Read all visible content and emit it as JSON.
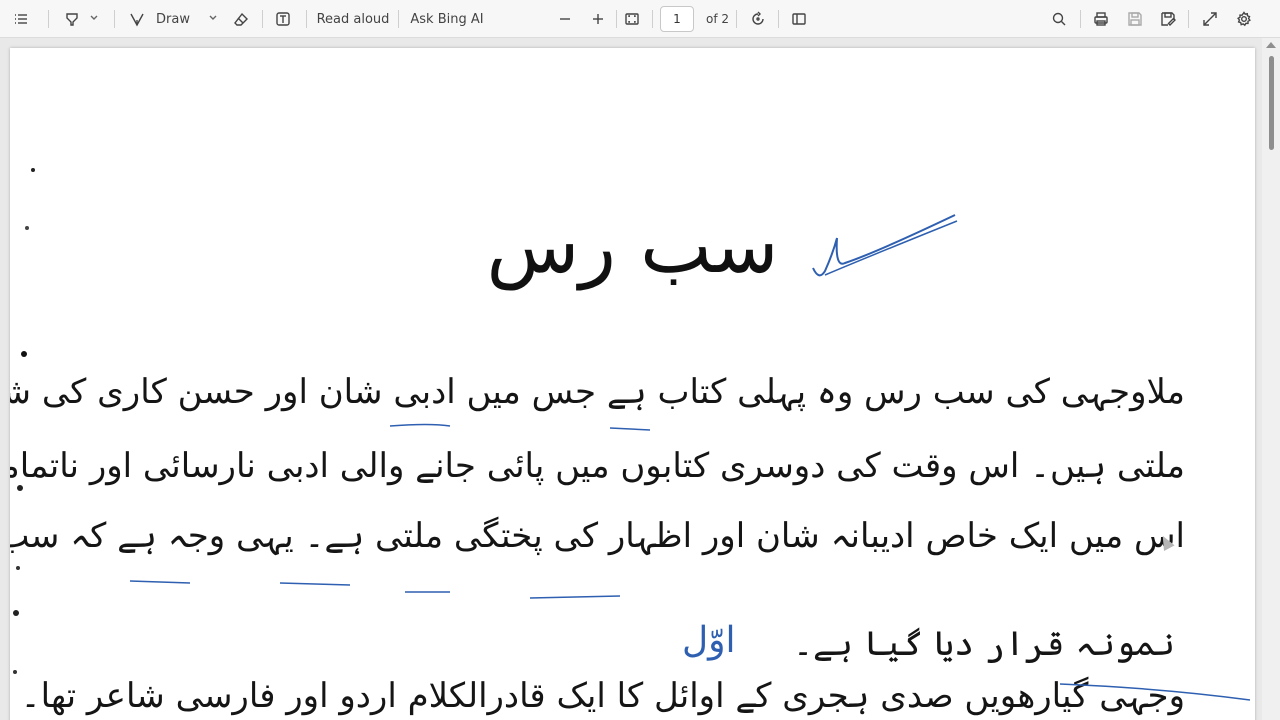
{
  "toolbar": {
    "contents_icon": "list-icon",
    "highlight_icon": "highlighter-icon",
    "draw_label": "Draw",
    "erase_icon": "eraser-icon",
    "text_icon": "text-box-icon",
    "read_aloud_label": "Read aloud",
    "ask_bing_label": "Ask Bing AI",
    "zoom_out_icon": "minus-icon",
    "zoom_in_icon": "plus-icon",
    "fit_icon": "fit-page-icon",
    "page_number": "1",
    "page_total": "of 2",
    "rotate_icon": "rotate-icon",
    "view_icon": "page-view-icon",
    "search_icon": "search-icon",
    "print_icon": "print-icon",
    "save_icon": "save-icon",
    "save_as_icon": "save-as-icon",
    "fullscreen_icon": "expand-icon",
    "settings_icon": "gear-icon"
  },
  "document": {
    "title": "سب رس",
    "lines": [
      "ملاوجہی کی سب رس وہ پہلی کتاب ہے جس میں ادبی شان اور حسن کاری کی شعوری کوششیں",
      "ملتی ہیں۔ اس وقت کی دوسری کتابوں میں پائی جانے والی ادبی نارسائی اور ناتمامی کے احساس کی جگہ",
      "اس میں ایک خاص ادیبانہ شان اور اظہار کی پختگی ملتی ہے۔ یہی وجہ ہے کہ سب رس کو اردو نثر کا اولین",
      "نمونہ قرار دیا گیا ہے۔",
      "وجہی گیارھویں صدی ہجری کے اوائل کا ایک قادرالکلام اردو اور فارسی شاعر تھا۔ قطب شاہی"
    ],
    "margin_note": "اوّل"
  },
  "colors": {
    "ink": "#151515",
    "pen_blue": "#2e5fb0",
    "toolbar_bg": "#f7f7f7",
    "viewer_bg": "#e9e9e9"
  }
}
